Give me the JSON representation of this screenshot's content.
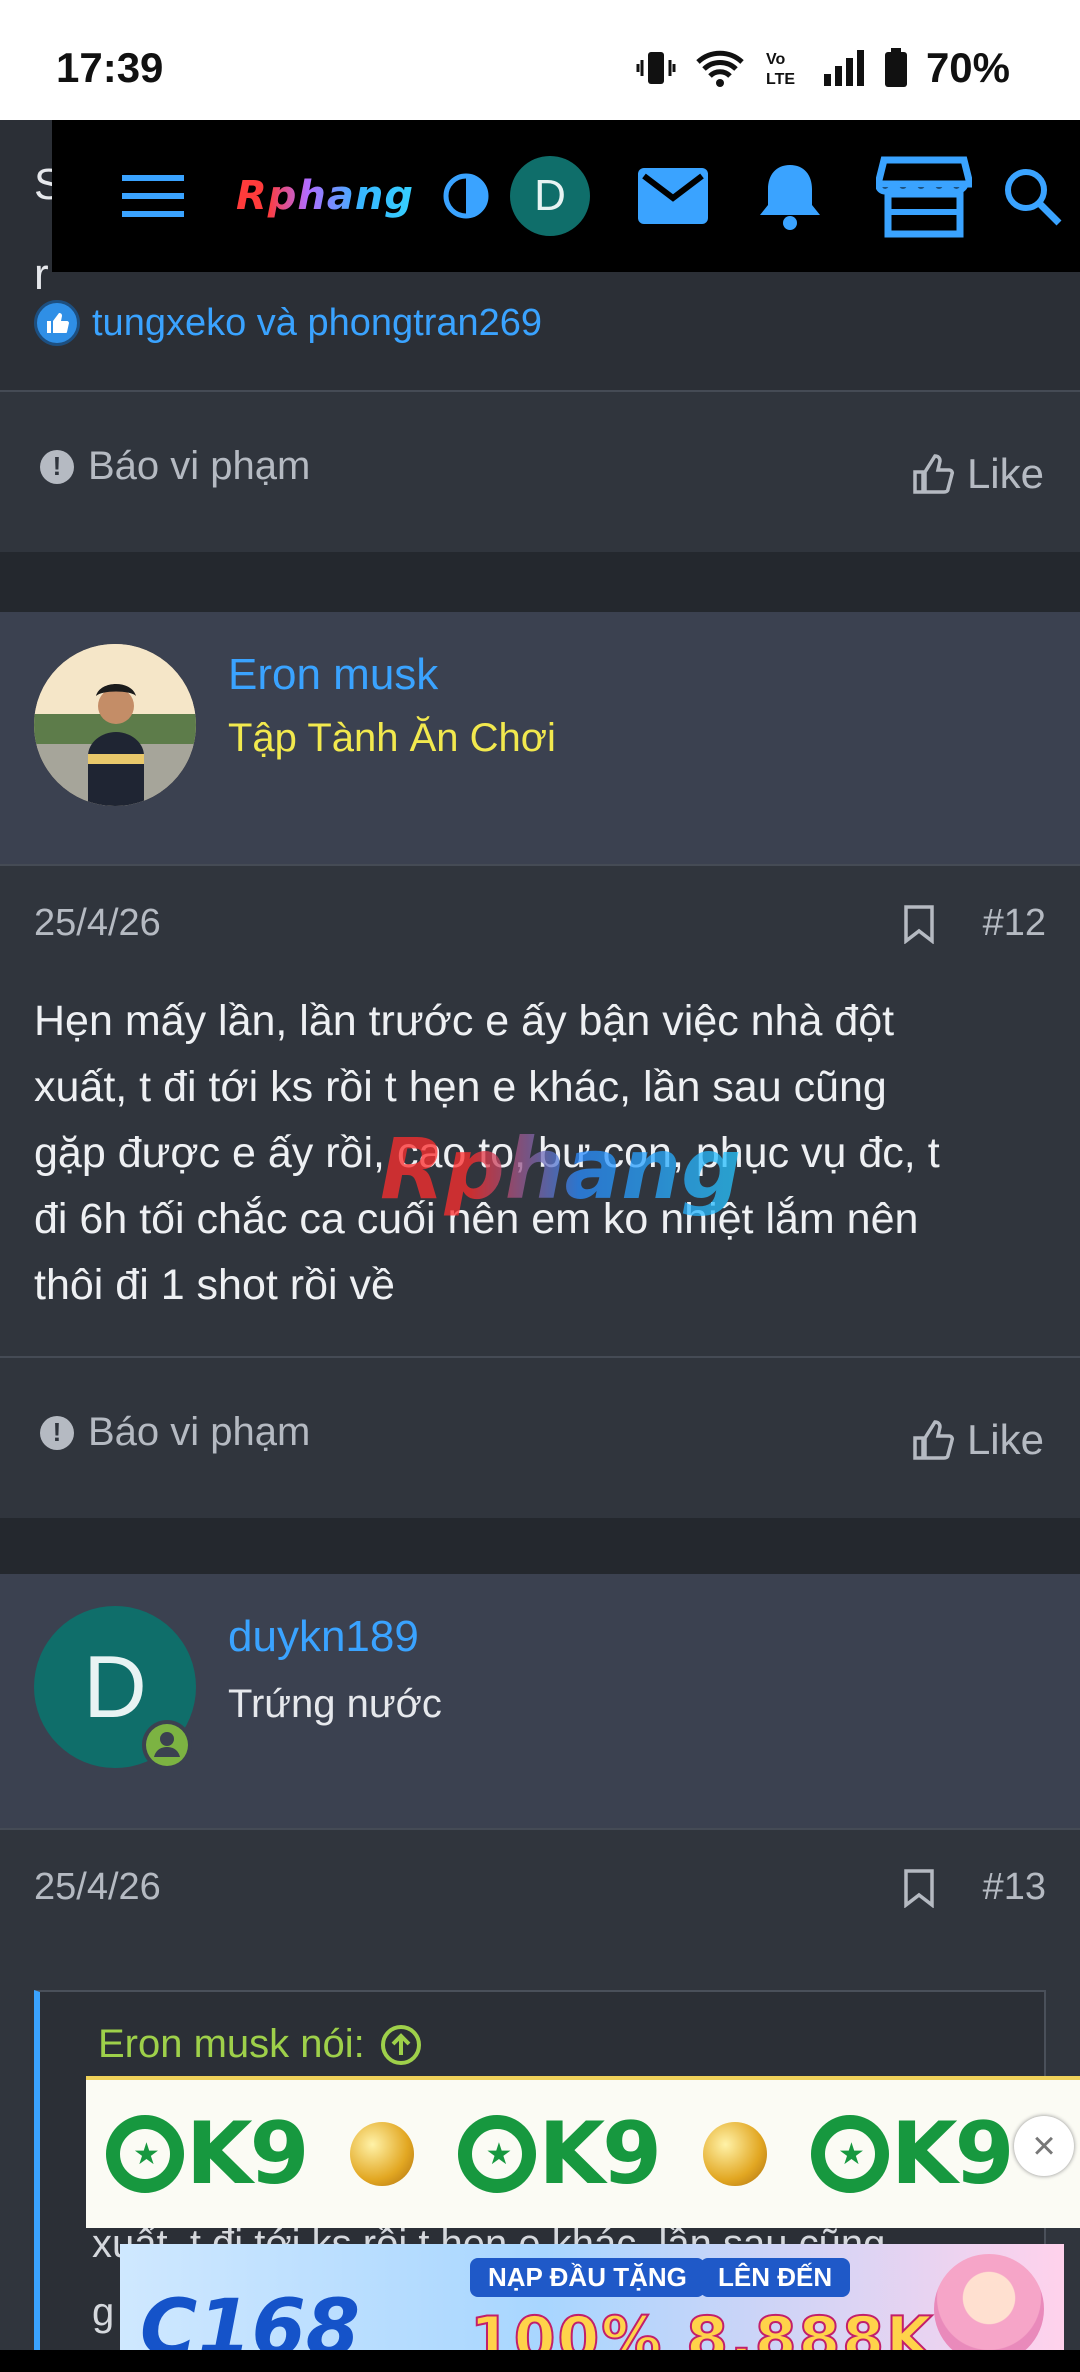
{
  "status_bar": {
    "time": "17:39",
    "volte": "Vo LTE",
    "battery": "70%"
  },
  "nav": {
    "logo": "Rphang",
    "avatar_letter": "D"
  },
  "top_partial": {
    "line1": "S",
    "line2": "r"
  },
  "previous_post": {
    "likers": "tungxeko và phongtran269",
    "report": "Báo vi phạm",
    "like": "Like"
  },
  "post12": {
    "username": "Eron musk",
    "user_title": "Tập Tành Ăn Chơi",
    "user_title_color": "#f2e94e",
    "date": "25/4/26",
    "number": "#12",
    "lines": [
      "Hẹn mấy lần, lần trước e ấy bận việc nhà đột",
      "xuất, t đi tới ks rồi t hẹn e khác, lần sau cũng",
      "gặp được e ấy rồi, cao to, bư con, phục vụ đc, t",
      "đi 6h tối chắc ca cuối nên em ko nhiệt lắm nên",
      "thôi đi 1 shot rồi về"
    ],
    "report": "Báo vi phạm",
    "like": "Like"
  },
  "post13": {
    "avatar_letter": "D",
    "username": "duykn189",
    "user_title": "Trứng nước",
    "date": "25/4/26",
    "number": "#13",
    "quote_author": "Eron musk nói:",
    "quote_line1": "xuất, t đi tới ks rồi t hẹn e khác, lần sau cũng",
    "quote_line2": "g"
  },
  "watermark": "Rphang",
  "ads": {
    "ok9_brand": "K9",
    "c168_brand": "C168",
    "c168_promo1": "NẠP ĐẦU TẶNG",
    "c168_promo2": "LÊN ĐẾN",
    "c168_amount": "100% 8.888K"
  },
  "colors": {
    "accent": "#3aa3ff",
    "background": "#2b2f36",
    "nav": "#000000",
    "ok9_green": "#17983f"
  }
}
